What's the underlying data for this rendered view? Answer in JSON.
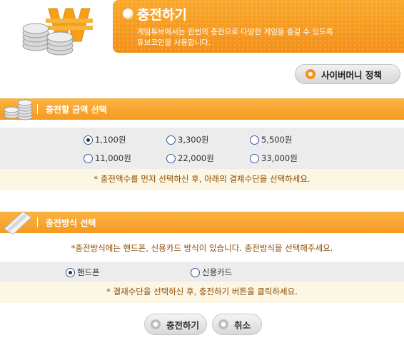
{
  "header": {
    "title": "충전하기",
    "description_line1": "게임튜브에서는 한번의 충전으로 다양한 게임을 즐길 수 있도록",
    "description_line2": "튜브코인을 사용합니다."
  },
  "policy_button": {
    "label": "사이버머니 정책"
  },
  "amount_section": {
    "title": "충전할 금액 선택",
    "options": [
      {
        "label": "1,100원",
        "selected": true
      },
      {
        "label": "3,300원",
        "selected": false
      },
      {
        "label": "5,500원",
        "selected": false
      },
      {
        "label": "11,000원",
        "selected": false
      },
      {
        "label": "22,000원",
        "selected": false
      },
      {
        "label": "33,000원",
        "selected": false
      }
    ],
    "note": "* 충전액수를 먼저 선택하신 후, 아래의 결제수단을 선택하세요."
  },
  "method_section": {
    "title": "충전방식 선택",
    "guide": "*충전방식에는 핸드폰, 신용카드 방식이 있습니다. 충전방식을 선택해주세요.",
    "options": [
      {
        "label": "핸드폰",
        "selected": true
      },
      {
        "label": "신용카드",
        "selected": false
      }
    ],
    "note": "* 결재수단을 선택하신 후, 충전하기 버튼을 클릭하세요."
  },
  "actions": {
    "charge_label": "충전하기",
    "cancel_label": "취소"
  },
  "colors": {
    "accent_orange": "#f59a21",
    "note_text": "#8a4a00",
    "note_bg": "#fcf6e4"
  }
}
